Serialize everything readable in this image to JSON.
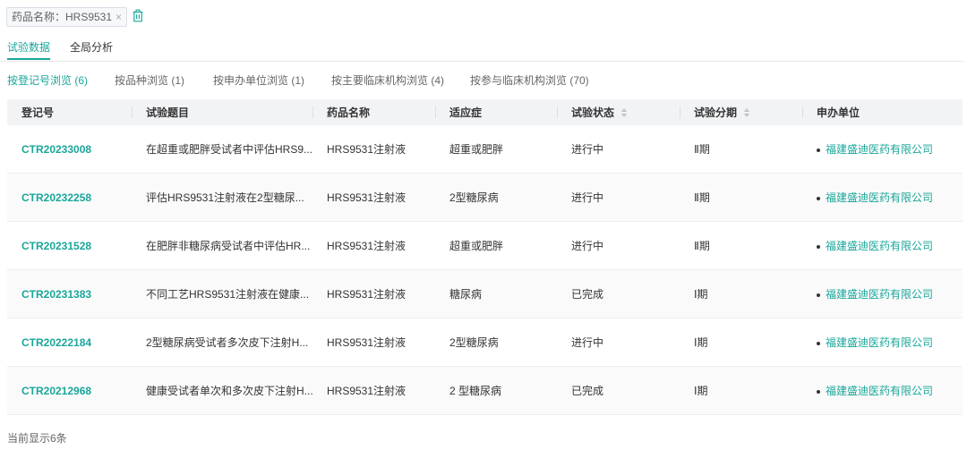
{
  "filter": {
    "label": "药品名称：HRS9531",
    "close": "×"
  },
  "tabs": [
    {
      "label": "试验数据",
      "active": true
    },
    {
      "label": "全局分析",
      "active": false
    }
  ],
  "subtabs": [
    {
      "label": "按登记号浏览 (6)",
      "active": true
    },
    {
      "label": "按品种浏览 (1)",
      "active": false
    },
    {
      "label": "按申办单位浏览 (1)",
      "active": false
    },
    {
      "label": "按主要临床机构浏览 (4)",
      "active": false
    },
    {
      "label": "按参与临床机构浏览 (70)",
      "active": false
    }
  ],
  "table": {
    "columns": [
      {
        "label": "登记号",
        "sortable": false
      },
      {
        "label": "试验题目",
        "sortable": false
      },
      {
        "label": "药品名称",
        "sortable": false
      },
      {
        "label": "适应症",
        "sortable": false
      },
      {
        "label": "试验状态",
        "sortable": true
      },
      {
        "label": "试验分期",
        "sortable": true
      },
      {
        "label": "申办单位",
        "sortable": false
      }
    ],
    "rows": [
      {
        "reg_no": "CTR20233008",
        "title": "在超重或肥胖受试者中评估HRS9...",
        "drug": "HRS9531注射液",
        "indication": "超重或肥胖",
        "status": "进行中",
        "phase": "Ⅱ期",
        "sponsor": "福建盛迪医药有限公司"
      },
      {
        "reg_no": "CTR20232258",
        "title": "评估HRS9531注射液在2型糖尿...",
        "drug": "HRS9531注射液",
        "indication": "2型糖尿病",
        "status": "进行中",
        "phase": "Ⅱ期",
        "sponsor": "福建盛迪医药有限公司"
      },
      {
        "reg_no": "CTR20231528",
        "title": "在肥胖非糖尿病受试者中评估HR...",
        "drug": "HRS9531注射液",
        "indication": "超重或肥胖",
        "status": "进行中",
        "phase": "Ⅱ期",
        "sponsor": "福建盛迪医药有限公司"
      },
      {
        "reg_no": "CTR20231383",
        "title": "不同工艺HRS9531注射液在健康...",
        "drug": "HRS9531注射液",
        "indication": "糖尿病",
        "status": "已完成",
        "phase": "Ⅰ期",
        "sponsor": "福建盛迪医药有限公司"
      },
      {
        "reg_no": "CTR20222184",
        "title": "2型糖尿病受试者多次皮下注射H...",
        "drug": "HRS9531注射液",
        "indication": "2型糖尿病",
        "status": "进行中",
        "phase": "Ⅰ期",
        "sponsor": "福建盛迪医药有限公司"
      },
      {
        "reg_no": "CTR20212968",
        "title": "健康受试者单次和多次皮下注射H...",
        "drug": "HRS9531注射液",
        "indication": "2 型糖尿病",
        "status": "已完成",
        "phase": "Ⅰ期",
        "sponsor": "福建盛迪医药有限公司"
      }
    ]
  },
  "footer": {
    "count_text": "当前显示6条"
  },
  "icons": {
    "remove_filter": "close-icon",
    "clear_filters": "trash-icon",
    "sort": "sort-icon",
    "sponsor_marker": "bullet-dot"
  },
  "colors": {
    "accent": "#1aa69a",
    "header_bg": "#f2f3f5",
    "text": "#333333",
    "muted": "#666666",
    "border": "#ebeef5"
  }
}
